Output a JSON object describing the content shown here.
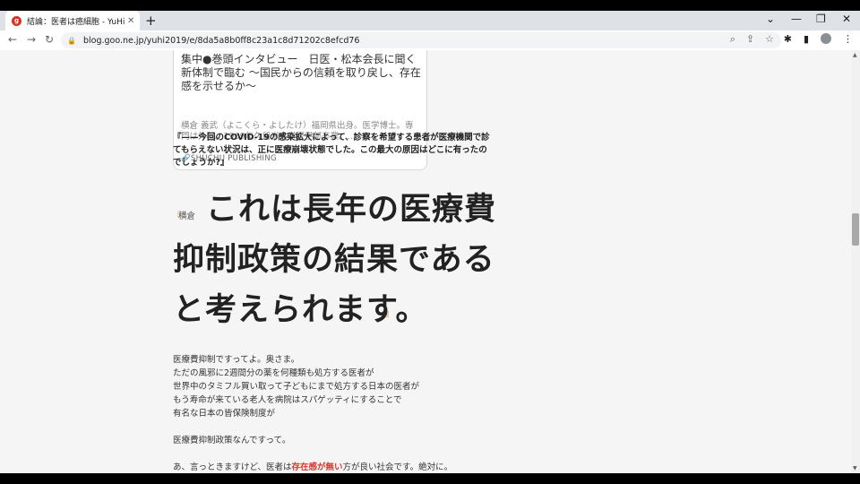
{
  "browser": {
    "tab_title": "結論：医者は癌細胞 - YuHiのブログ",
    "favicon": "goo",
    "tab_close": "✕",
    "new_tab": "+",
    "url": "blog.goo.ne.jp/yuhi2019/e/8da5a8b0ff8c23a1c8d71202c8efcd76",
    "icons": {
      "back": "←",
      "forward": "→",
      "reload": "↻",
      "lock": "🔒",
      "zoom": "⌕",
      "share": "⇪",
      "star": "☆",
      "extensions": "✱",
      "sidepanel": "▮",
      "menu": "⋮",
      "minimize": "—",
      "restore": "❐",
      "close": "✕",
      "tabsearch": "⌄"
    }
  },
  "card": {
    "title": "集中●巻頭インタビュー　日医・松本会長に聞く　新体制で臨む 〜国民からの信頼を取り戻し、存在感を示せるか〜",
    "desc": "横倉 義武（よこくら・よしたけ）福岡県出身。医学博士。専門は外科。1969年久留米大学医学部卒業。...",
    "source": "🔗SHUCHU PUBLISHING"
  },
  "article": {
    "quote": "『——今回のCOVID-19の感染拡大によって、診察を希望する患者が医療機関で診てもらえない状況は、正に医療崩壊状態でした。この最大の原因はどこに有ったのでしょうか?』",
    "big_open": "『",
    "big_speaker": "横倉",
    "big_line1": "これは長年の医療費",
    "big_line2": "抑制政策の結果である",
    "big_line3": "と考えられます。",
    "big_close": "』",
    "para_lines": [
      "医療費抑制ですってよ。奥さま。",
      "ただの風邪に2週間分の薬を何種類も処方する医者が",
      "世界中のタミフル買い取って子どもにまで処方する日本の医者が",
      "もう寿命が来ている老人を病院はスパゲッティにすることで",
      "有名な日本の皆保険制度が"
    ],
    "para2": "医療費抑制政策なんですって。",
    "para3_pre": "あ、言っときますけど、医者は",
    "para3_red": "存在感が無い",
    "para3_post": "方が良い社会です。絶対に。"
  }
}
